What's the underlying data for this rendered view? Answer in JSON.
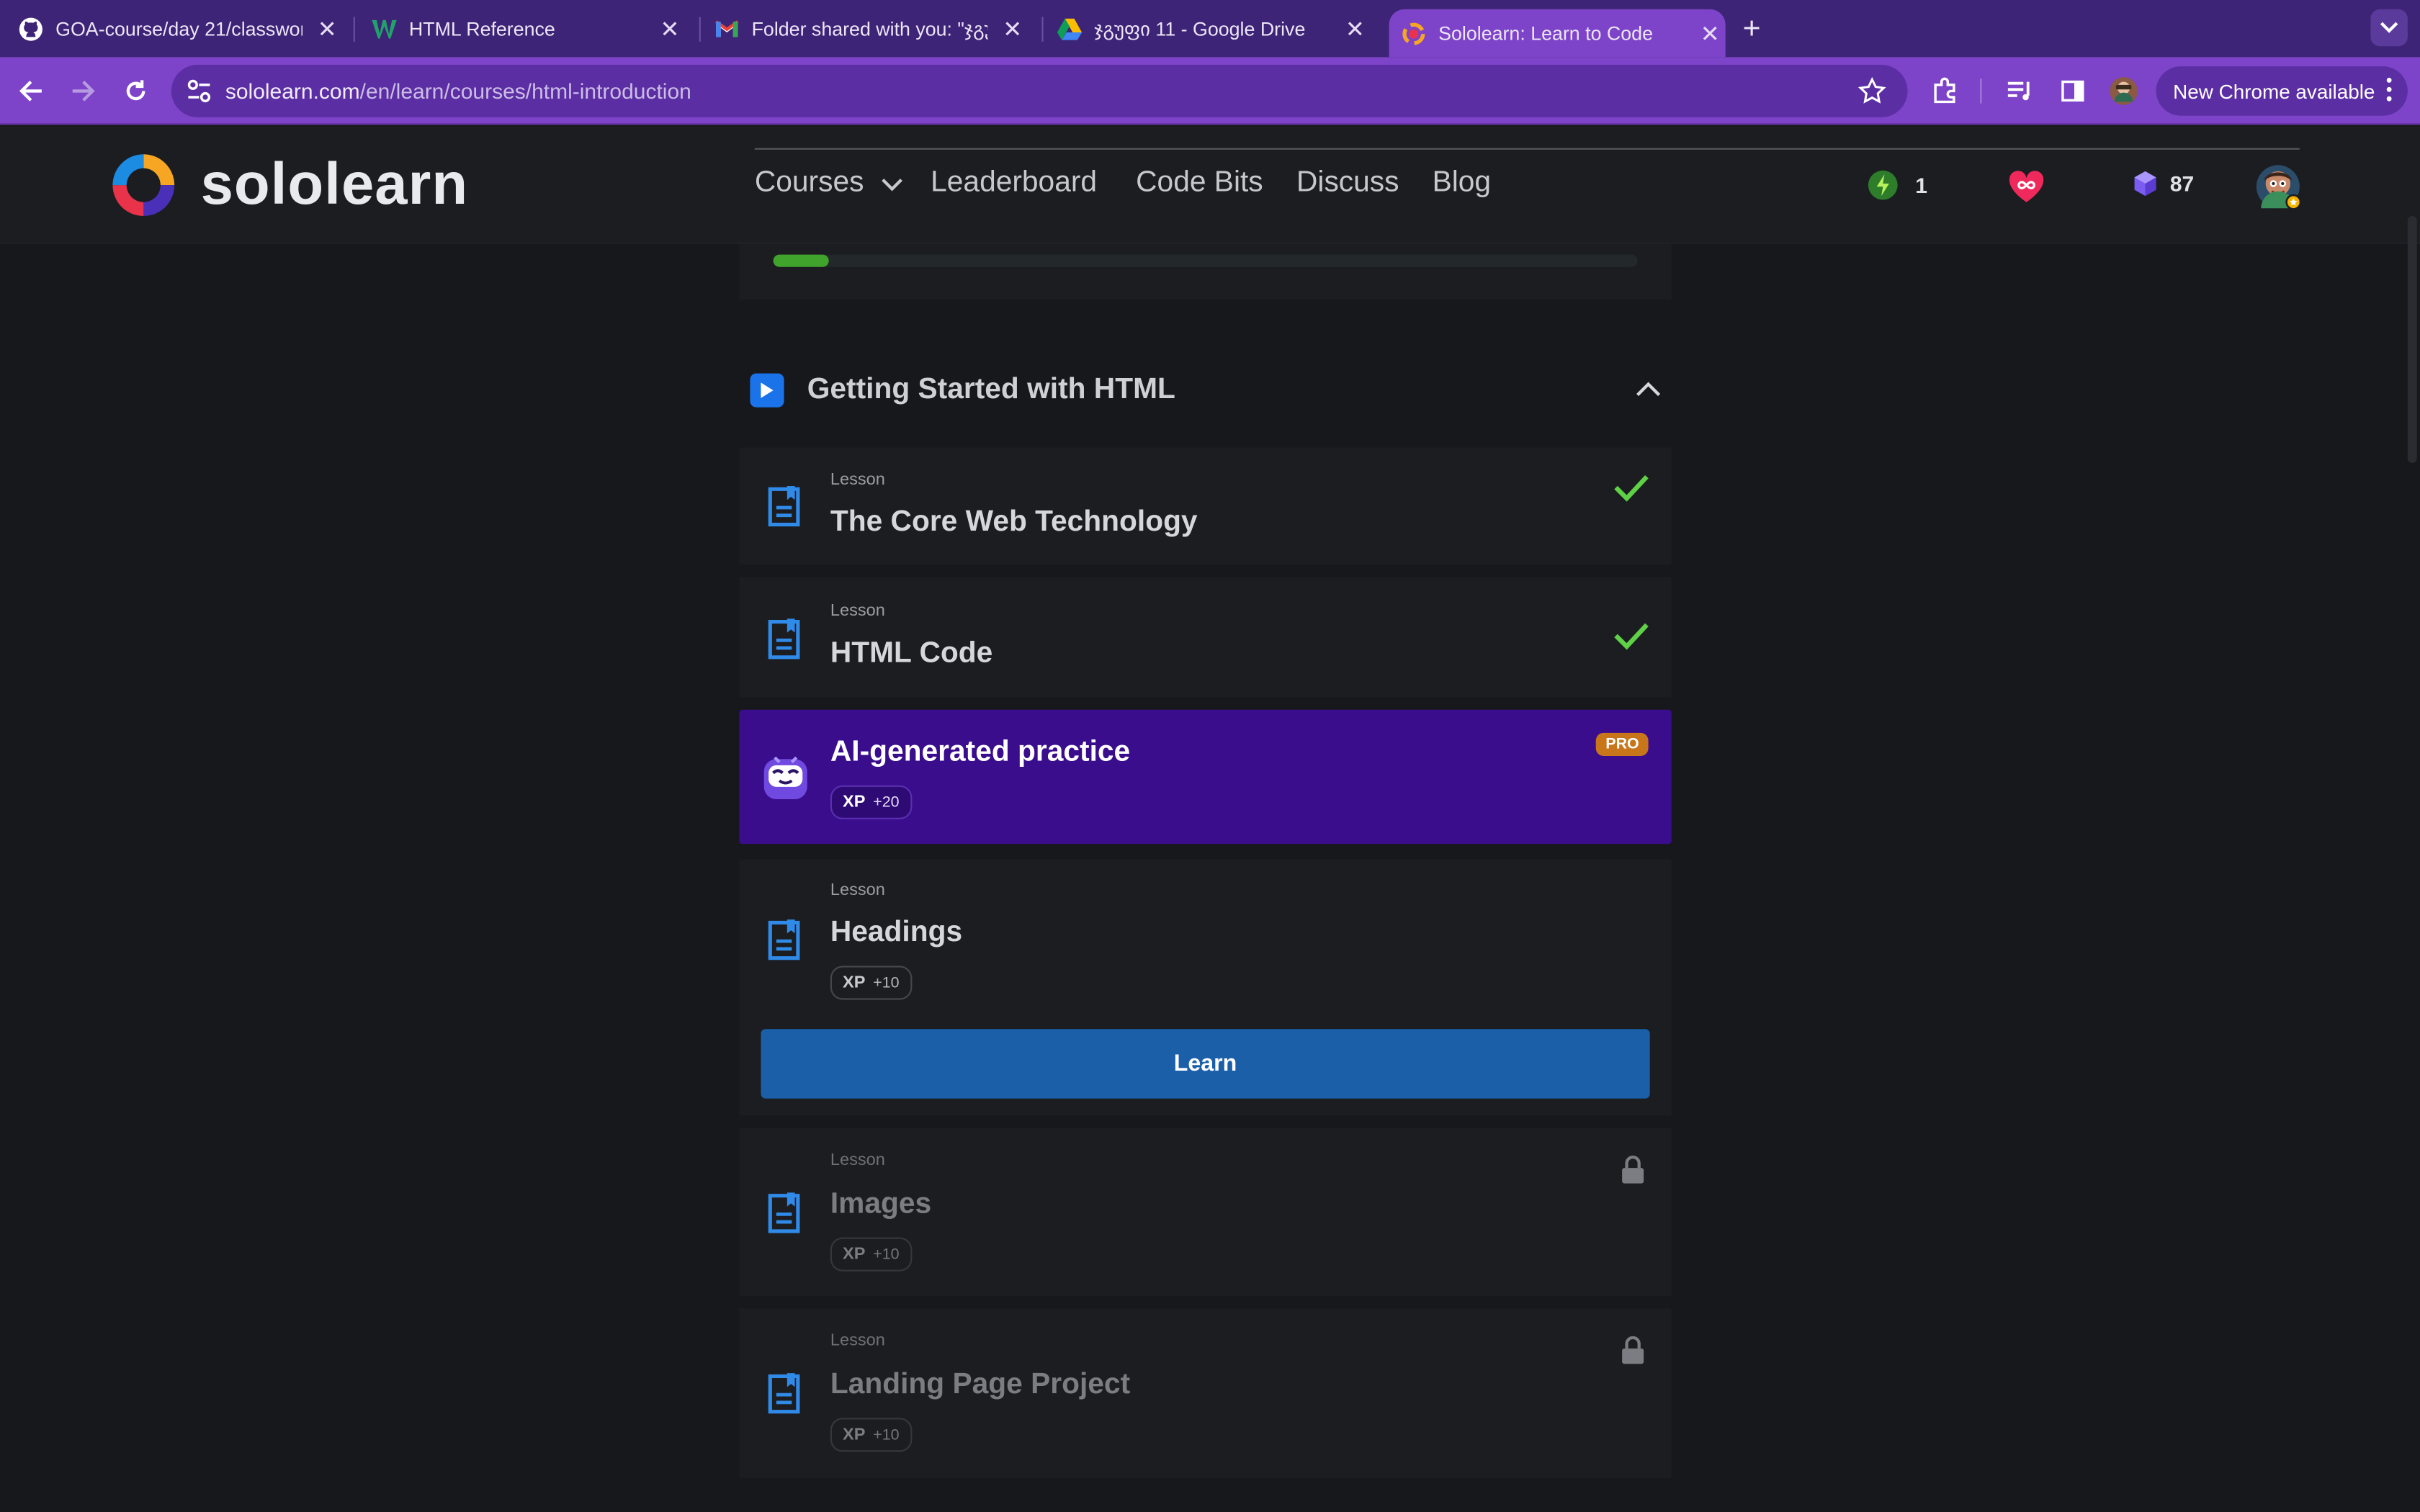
{
  "browser": {
    "tabs": [
      {
        "title": "GOA-course/day 21/classwork",
        "icon": "github-icon"
      },
      {
        "title": "HTML Reference",
        "icon": "w3-icon"
      },
      {
        "title": "Folder shared with you: \"ჯგუ",
        "icon": "gmail-icon"
      },
      {
        "title": "ჯგუფი 11 - Google Drive",
        "icon": "google-drive-icon"
      },
      {
        "title": "Sololearn: Learn to Code",
        "icon": "sololearn-icon",
        "active": true
      }
    ],
    "url_host": "sololearn.com",
    "url_path": "/en/learn/courses/html-introduction",
    "update_label": "New Chrome available",
    "theme_color": "#7d43c9"
  },
  "site": {
    "logo_text": "sololearn",
    "nav": {
      "courses": "Courses",
      "leaderboard": "Leaderboard",
      "code_bits": "Code Bits",
      "discuss": "Discuss",
      "blog": "Blog"
    },
    "stats": {
      "streak": "1",
      "bits": "87"
    }
  },
  "course": {
    "progress": 0.065,
    "module_title": "Getting Started with HTML",
    "lesson_kind": "Lesson",
    "lessons": [
      {
        "title": "The Core Web Technology",
        "status": "completed"
      },
      {
        "title": "HTML Code",
        "status": "completed"
      },
      {
        "title": "Headings",
        "status": "current",
        "xp_label": "XP",
        "xp_value": "+10"
      },
      {
        "title": "Images",
        "status": "locked",
        "xp_label": "XP",
        "xp_value": "+10"
      },
      {
        "title": "Landing Page Project",
        "status": "locked",
        "xp_label": "XP",
        "xp_value": "+10"
      }
    ],
    "ai_practice": {
      "title": "AI-generated practice",
      "badge": "PRO",
      "xp_label": "XP",
      "xp_value": "+20"
    },
    "learn_button": "Learn"
  },
  "colors": {
    "accent_blue": "#1a5fa8",
    "check_green": "#5fd146",
    "ai_purple": "#3a0d8c",
    "pro_orange": "#c9761b"
  }
}
